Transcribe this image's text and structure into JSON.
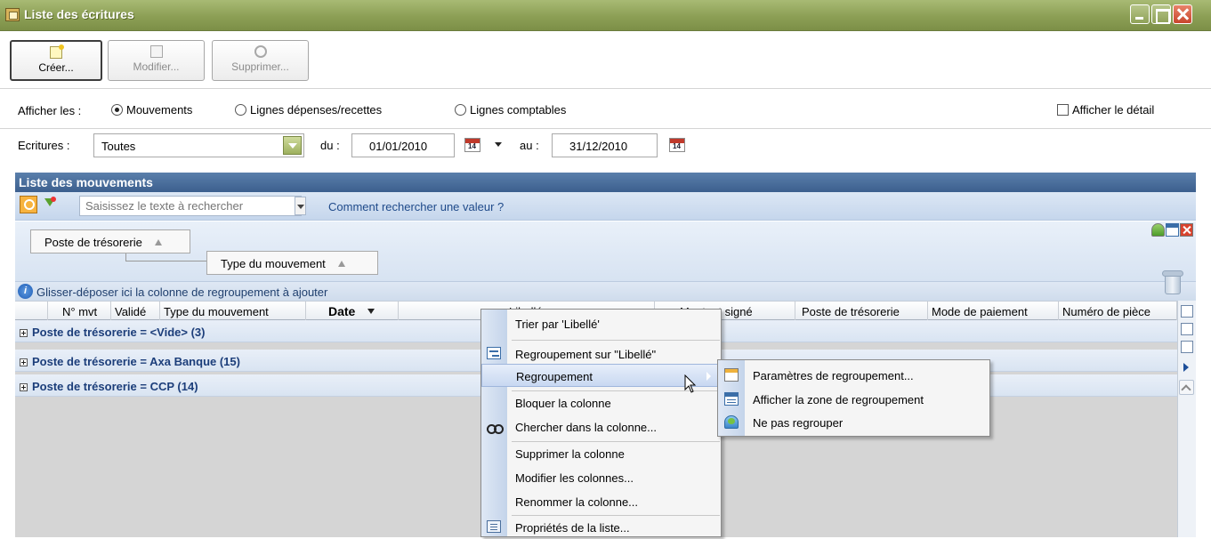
{
  "window": {
    "title": "Liste des écritures"
  },
  "toolbar": {
    "create_label": "Créer...",
    "modify_label": "Modifier...",
    "delete_label": "Supprimer..."
  },
  "display": {
    "label": "Afficher les :",
    "options": [
      "Mouvements",
      "Lignes dépenses/recettes",
      "Lignes comptables"
    ],
    "selected": "Mouvements",
    "detail_checkbox_label": "Afficher le détail",
    "detail_checked": false
  },
  "filter": {
    "label": "Ecritures :",
    "value": "Toutes",
    "from_label": "du :",
    "from_date": "01/01/2010",
    "to_label": "au :",
    "to_date": "31/12/2010"
  },
  "grid": {
    "title": "Liste des mouvements",
    "search_placeholder": "Saisissez le texte à rechercher",
    "search_help": "Comment rechercher une valeur ?",
    "group_chips": [
      "Poste de trésorerie",
      "Type du mouvement"
    ],
    "hint": "Glisser-déposer ici la colonne de regroupement à ajouter",
    "columns": [
      "N° mvt",
      "Validé",
      "Type du mouvement",
      "Date",
      "Libellé",
      "Montant signé",
      "Poste de trésorerie",
      "Mode de paiement",
      "Numéro de pièce"
    ],
    "sorted_column": "Date",
    "groups": [
      "Poste de trésorerie = <Vide> (3)",
      "Poste de trésorerie = Axa Banque (15)",
      "Poste de trésorerie = CCP (14)"
    ]
  },
  "context_menu": {
    "items": [
      "Trier par 'Libellé'",
      "Regroupement sur \"Libellé\"",
      "Regroupement",
      "Bloquer la colonne",
      "Chercher dans la colonne...",
      "Supprimer la colonne",
      "Modifier les colonnes...",
      "Renommer la colonne...",
      "Propriétés de la liste..."
    ],
    "highlighted": "Regroupement"
  },
  "submenu": {
    "items": [
      "Paramètres de regroupement...",
      "Afficher la zone de regroupement",
      "Ne pas regrouper"
    ]
  },
  "colors": {
    "title_bar": "#8c9f55",
    "grid_header": "#3c5f8e",
    "group_text": "#1c3e7a",
    "close_button": "#c8452c"
  }
}
